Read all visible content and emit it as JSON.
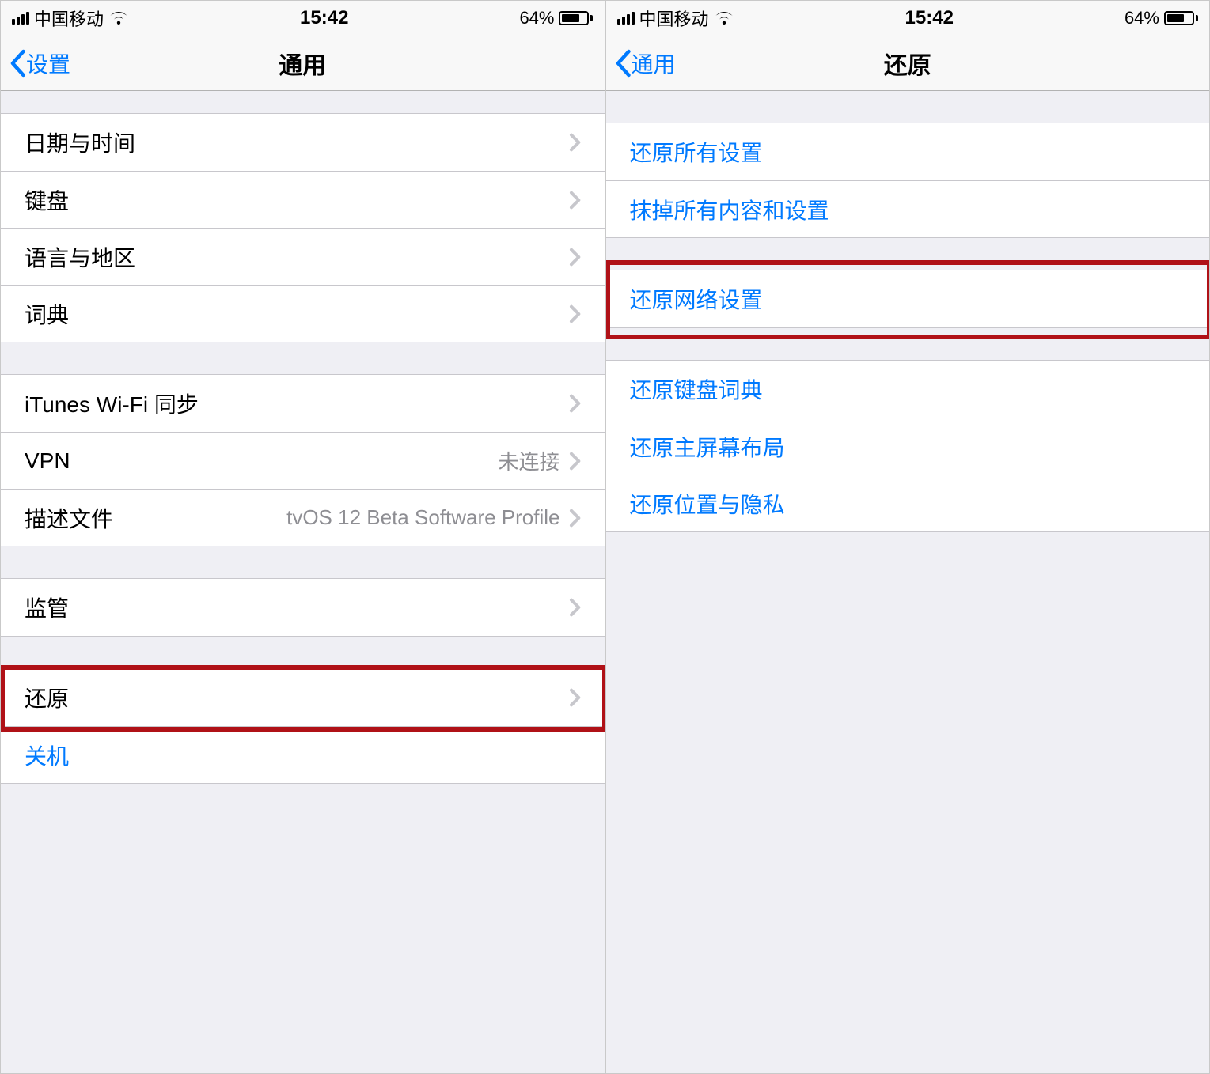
{
  "status": {
    "carrier": "中国移动",
    "time": "15:42",
    "battery_pct": "64%"
  },
  "left": {
    "nav": {
      "back": "设置",
      "title": "通用"
    },
    "g1": {
      "i0": "日期与时间",
      "i1": "键盘",
      "i2": "语言与地区",
      "i3": "词典"
    },
    "g2": {
      "i0": "iTunes Wi-Fi 同步",
      "i1": "VPN",
      "i1_val": "未连接",
      "i2": "描述文件",
      "i2_val": "tvOS 12 Beta Software Profile"
    },
    "g3": {
      "i0": "监管"
    },
    "g4": {
      "i0": "还原",
      "i1": "关机"
    }
  },
  "right": {
    "nav": {
      "back": "通用",
      "title": "还原"
    },
    "g1": {
      "i0": "还原所有设置",
      "i1": "抹掉所有内容和设置"
    },
    "g2": {
      "i0": "还原网络设置"
    },
    "g3": {
      "i0": "还原键盘词典",
      "i1": "还原主屏幕布局",
      "i2": "还原位置与隐私"
    }
  }
}
